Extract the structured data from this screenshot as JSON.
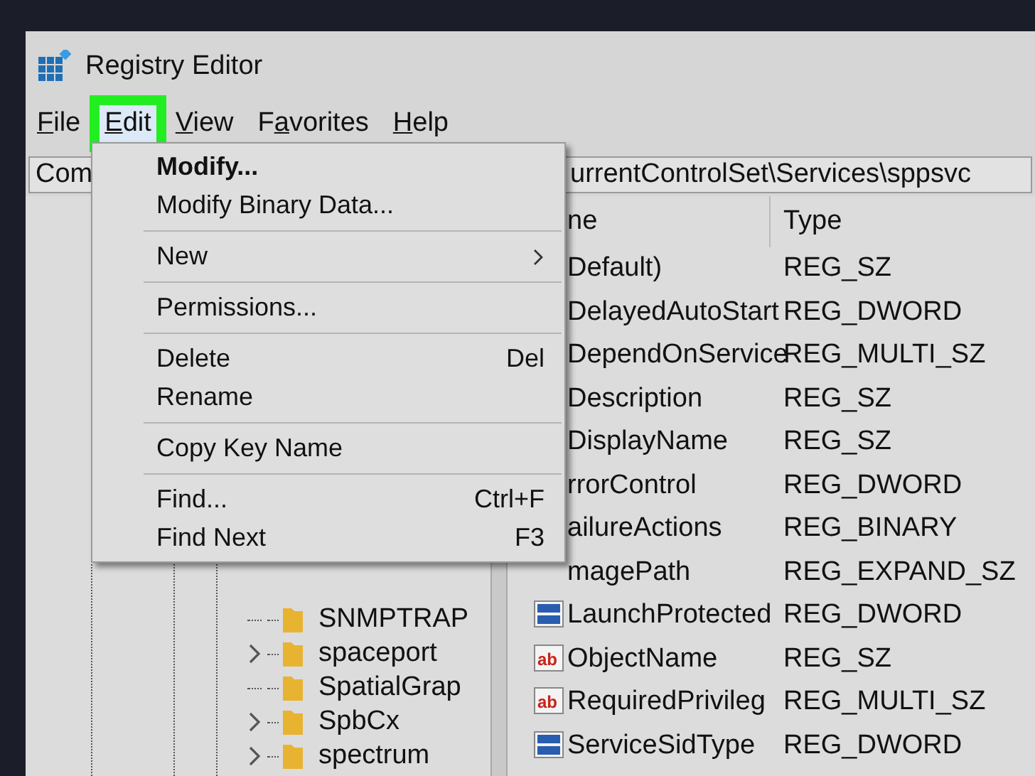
{
  "window": {
    "title": "Registry Editor"
  },
  "menu_bar": [
    {
      "key": "F",
      "rest": "ile",
      "selected": false,
      "outlined": false
    },
    {
      "key": "E",
      "rest": "dit",
      "selected": true,
      "outlined": true
    },
    {
      "key": "V",
      "rest": "iew",
      "selected": false,
      "outlined": false
    },
    {
      "lead": "F",
      "key": "a",
      "rest": "vorites",
      "selected": false,
      "outlined": false
    },
    {
      "key": "H",
      "rest": "elp",
      "selected": false,
      "outlined": false
    }
  ],
  "address_bar": {
    "parts": [
      "Com",
      "urrentControlSet\\Services\\sppsvc"
    ]
  },
  "tree": [
    {
      "label": "SNMPTRAP",
      "expandable": false
    },
    {
      "label": "spaceport",
      "expandable": true
    },
    {
      "label": "SpatialGrap",
      "expandable": false
    },
    {
      "label": "SpbCx",
      "expandable": true
    },
    {
      "label": "spectrum",
      "expandable": true
    }
  ],
  "values": {
    "columns": [
      "ne",
      "Type"
    ],
    "rows": [
      {
        "name": "Default)",
        "type": "REG_SZ"
      },
      {
        "name": "DelayedAutoStart",
        "type": "REG_DWORD"
      },
      {
        "name": "DependOnService",
        "type": "REG_MULTI_SZ"
      },
      {
        "name": "Description",
        "type": "REG_SZ"
      },
      {
        "name": "DisplayName",
        "type": "REG_SZ"
      },
      {
        "name": "rrorControl",
        "type": "REG_DWORD"
      },
      {
        "name": "ailureActions",
        "type": "REG_BINARY"
      },
      {
        "name": "magePath",
        "type": "REG_EXPAND_SZ"
      },
      {
        "name": "LaunchProtected",
        "type": "REG_DWORD",
        "kind": "binary"
      },
      {
        "name": "ObjectName",
        "type": "REG_SZ",
        "kind": "string",
        "icon_label": "ab"
      },
      {
        "name": "RequiredPrivileg",
        "type": "REG_MULTI_SZ",
        "kind": "string",
        "icon_label": "ab"
      },
      {
        "name": "ServiceSidType",
        "type": "REG_DWORD",
        "kind": "binary"
      }
    ]
  },
  "edit_menu": {
    "groups": [
      [
        {
          "label": "Modify...",
          "default": true,
          "submenu": false
        },
        {
          "label": "Modify Binary Data...",
          "default": false,
          "submenu": false
        }
      ],
      [
        {
          "label": "New",
          "default": false,
          "submenu": true
        }
      ],
      [
        {
          "label": "Permissions...",
          "default": false,
          "submenu": false
        }
      ],
      [
        {
          "label": "Delete",
          "shortcut": "Del",
          "default": false,
          "submenu": false
        },
        {
          "label": "Rename",
          "default": false,
          "submenu": false
        }
      ],
      [
        {
          "label": "Copy Key Name",
          "default": false,
          "submenu": false
        }
      ],
      [
        {
          "label": "Find...",
          "shortcut": "Ctrl+F",
          "default": false,
          "submenu": false
        },
        {
          "label": "Find Next",
          "shortcut": "F3",
          "default": false,
          "submenu": false
        }
      ]
    ]
  }
}
